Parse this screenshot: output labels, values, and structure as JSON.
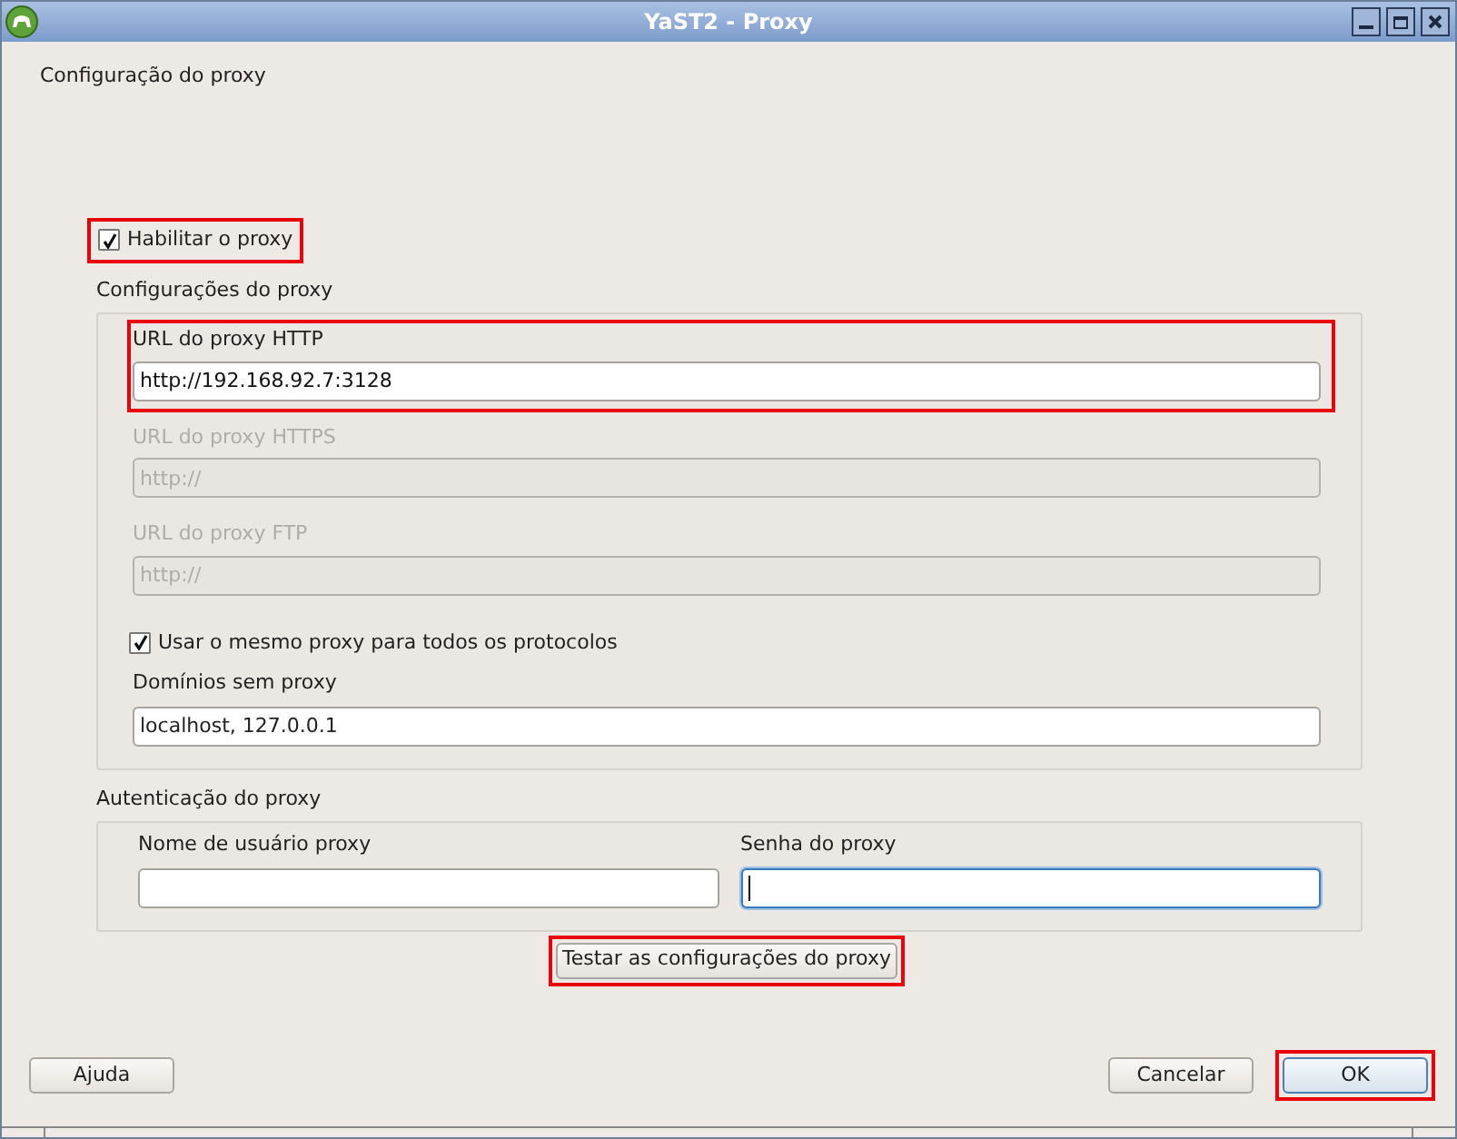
{
  "window": {
    "title": "YaST2 - Proxy"
  },
  "heading": "Configuração do proxy",
  "enable_proxy": {
    "label": "Habilitar o proxy",
    "checked": true,
    "highlighted": true
  },
  "settings_group": {
    "title": "Configurações do proxy",
    "url_fields": [
      {
        "label": "URL do proxy HTTP",
        "value": "http://192.168.92.7:3128",
        "disabled": false,
        "highlighted": true
      },
      {
        "label": "URL do proxy HTTPS",
        "value": "http://",
        "disabled": true,
        "highlighted": false
      },
      {
        "label": "URL do proxy FTP",
        "value": "http://",
        "disabled": true,
        "highlighted": false
      }
    ],
    "same_proxy": {
      "label": "Usar o mesmo proxy para todos os protocolos",
      "checked": true
    },
    "no_proxy": {
      "label": "Domínios sem proxy",
      "value": "localhost, 127.0.0.1"
    }
  },
  "auth_group": {
    "title": "Autenticação do proxy",
    "fields": [
      {
        "label": "Nome de usuário proxy",
        "focused": false
      },
      {
        "label": "Senha do proxy",
        "focused": true
      }
    ]
  },
  "test_button": {
    "label": "Testar as configurações do proxy",
    "highlighted": true
  },
  "buttons": [
    {
      "label": "Ajuda",
      "highlighted": false,
      "default": false
    },
    {
      "label": "Cancelar",
      "highlighted": false,
      "default": false
    },
    {
      "label": "OK",
      "highlighted": true,
      "default": true
    }
  ]
}
